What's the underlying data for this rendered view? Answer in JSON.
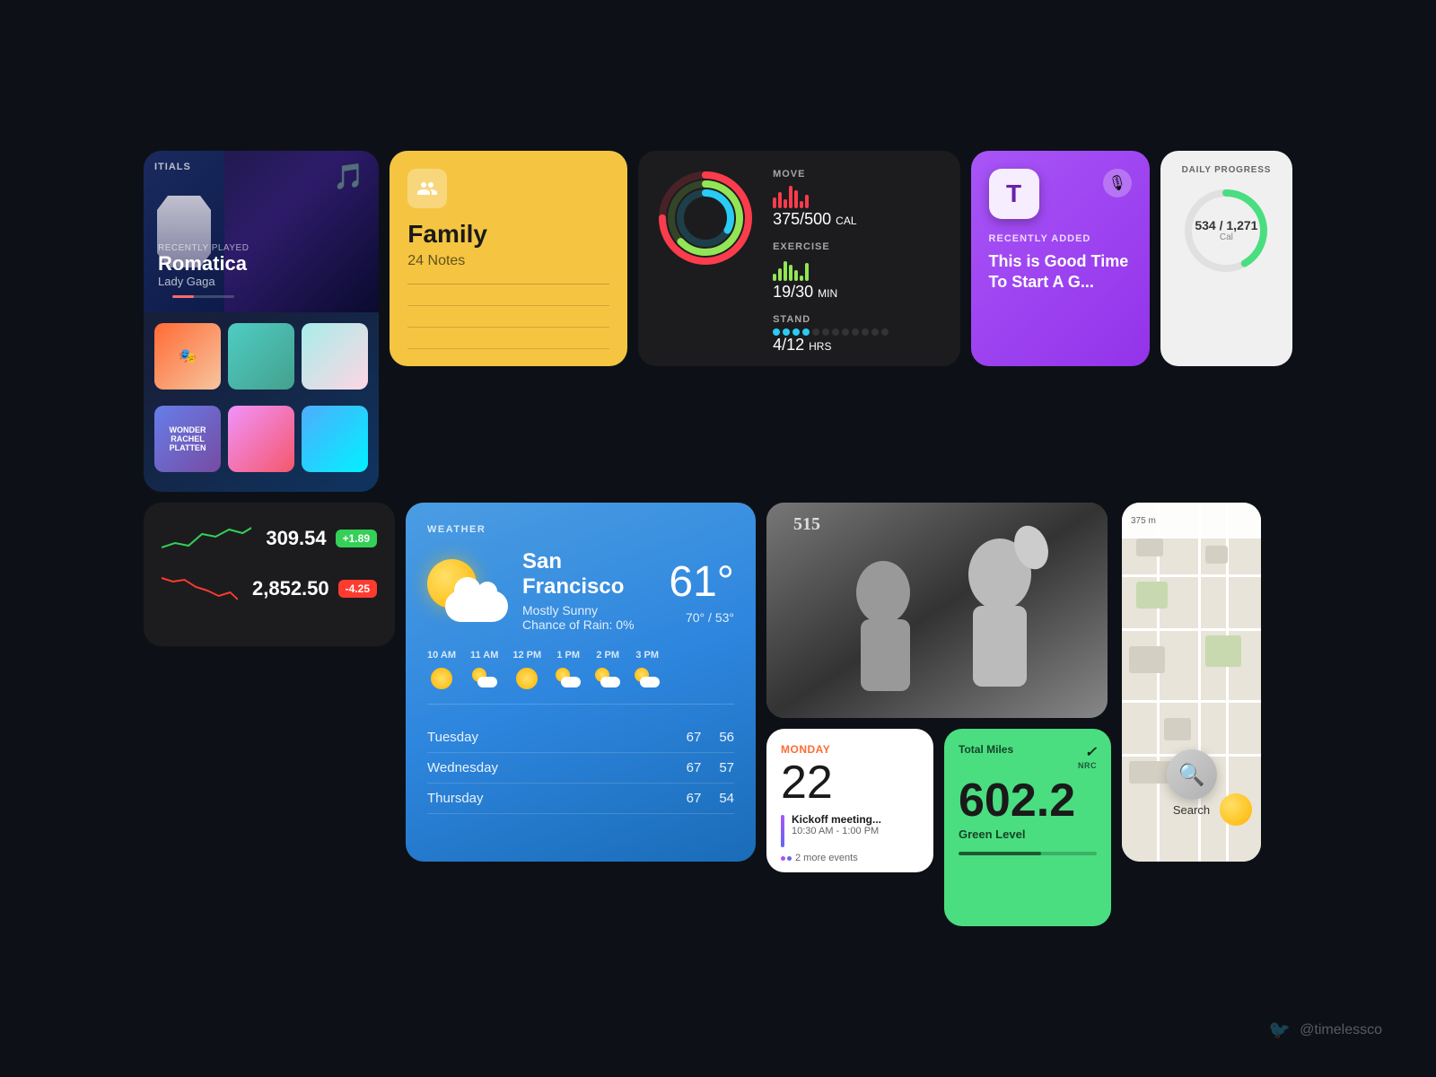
{
  "music": {
    "label": "RECENTLY PLAYED",
    "song": "Romatica",
    "artist": "Lady Gaga",
    "album_title": "ITIALS",
    "note_emoji": "🎵"
  },
  "notes": {
    "title": "Family",
    "subtitle": "24 Notes",
    "icon_type": "people"
  },
  "activity": {
    "move_label": "MOVE",
    "move_value": "375/500",
    "move_unit": "CAL",
    "exercise_label": "EXERCISE",
    "exercise_value": "19/30",
    "exercise_unit": "MIN",
    "stand_label": "STAND",
    "stand_value": "4/12",
    "stand_unit": "HRS"
  },
  "podcast": {
    "recently_added": "RECENTLY ADDED",
    "title": "This is Good Time To Start A G...",
    "t_letter": "T"
  },
  "daily_progress": {
    "label": "DAILY PROGRESS",
    "value": "534 / 1,271",
    "unit": "Cal",
    "percent": 42
  },
  "weather": {
    "label": "WEATHER",
    "city": "San Francisco",
    "description": "Mostly Sunny",
    "rain": "Chance of Rain: 0%",
    "temp": "61°",
    "high": "70°",
    "low": "53°",
    "hourly": [
      {
        "time": "10 AM",
        "type": "sun"
      },
      {
        "time": "11 AM",
        "type": "cloud-sun"
      },
      {
        "time": "12 PM",
        "type": "sun"
      },
      {
        "time": "1 PM",
        "type": "cloud-sun"
      },
      {
        "time": "2 PM",
        "type": "cloud-sun"
      },
      {
        "time": "3 PM",
        "type": "cloud-sun"
      }
    ],
    "forecast": [
      {
        "day": "Tuesday",
        "high": "67",
        "low": "56"
      },
      {
        "day": "Wednesday",
        "high": "67",
        "low": "57"
      },
      {
        "day": "Thursday",
        "high": "67",
        "low": "54"
      }
    ]
  },
  "calendar": {
    "day": "MONDAY",
    "date": "22",
    "event_title": "Kickoff meeting...",
    "event_time": "10:30 AM - 1:00 PM",
    "more_events": "2 more events"
  },
  "nike": {
    "label": "Total Miles",
    "logo": "✓",
    "nrc": "NRC",
    "miles": "602.2",
    "sublabel": "Green Level"
  },
  "map": {
    "search_label": "Search",
    "overlay_text": "375 m"
  },
  "stocks": [
    {
      "price": "309.54",
      "change": "+1.89",
      "positive": true
    },
    {
      "price": "2,852.50",
      "change": "-4.25",
      "positive": false
    }
  ],
  "footer": {
    "twitter_handle": "@timelessco"
  }
}
